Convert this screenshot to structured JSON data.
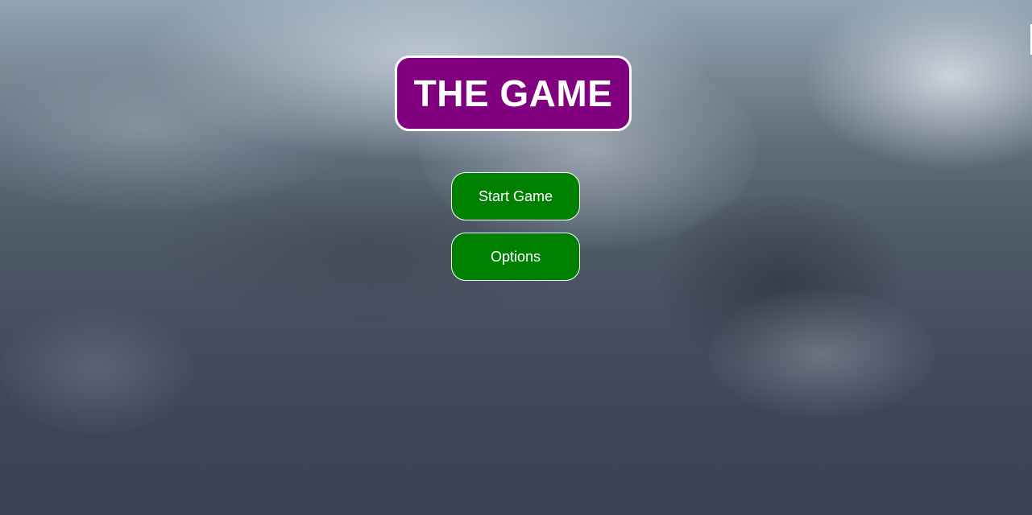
{
  "menu": {
    "title": "THE GAME",
    "buttons": [
      {
        "label": "Start Game"
      },
      {
        "label": "Options"
      }
    ]
  },
  "colors": {
    "title_background": "#800080",
    "button_background": "#008000",
    "text": "#ffffff",
    "border": "#ffffff"
  },
  "background": {
    "scene": "stormy cloudy sky"
  }
}
